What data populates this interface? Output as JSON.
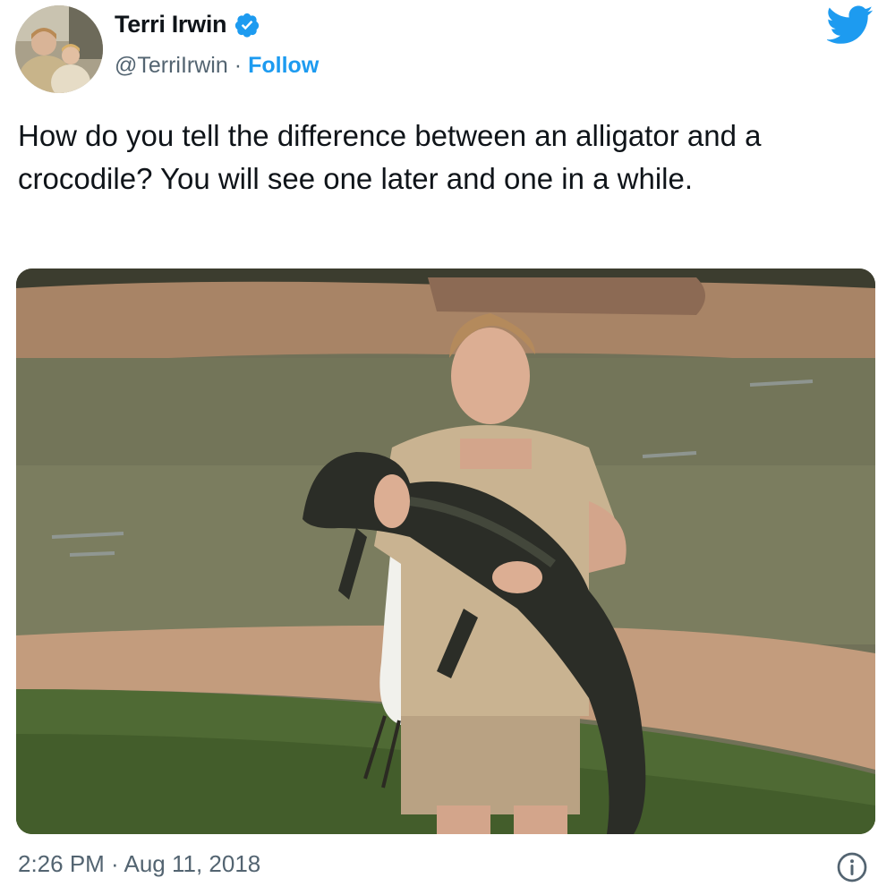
{
  "author": {
    "display_name": "Terri Irwin",
    "handle": "@TerriIrwin",
    "separator": "·",
    "follow_label": "Follow",
    "verified": true
  },
  "tweet": {
    "text": "How do you tell the difference between an alligator and a crocodile? You will see one later and one in a while."
  },
  "meta": {
    "timestamp": "2:26 PM · Aug 11, 2018"
  },
  "icons": {
    "verified": "verified-badge-icon",
    "logo": "twitter-bird-icon",
    "info": "info-icon"
  },
  "colors": {
    "accent": "#1d9bf0",
    "text": "#0f1419",
    "secondary": "#536471"
  }
}
